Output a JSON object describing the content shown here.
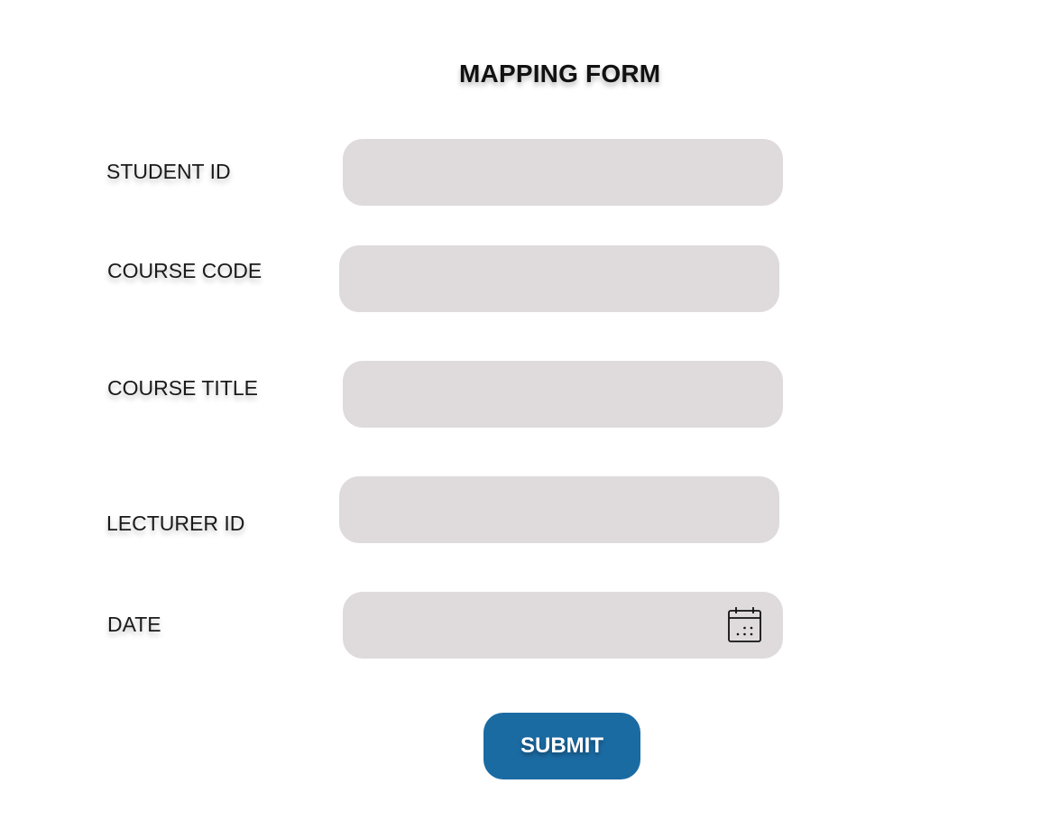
{
  "form": {
    "title": "MAPPING FORM",
    "fields": [
      {
        "label": "STUDENT ID",
        "value": "",
        "placeholder": ""
      },
      {
        "label": "COURSE CODE",
        "value": "",
        "placeholder": ""
      },
      {
        "label": "COURSE TITLE",
        "value": "",
        "placeholder": ""
      },
      {
        "label": "LECTURER ID",
        "value": "",
        "placeholder": ""
      },
      {
        "label": "DATE",
        "value": "",
        "placeholder": "",
        "icon": "calendar-icon"
      }
    ],
    "submit_label": "SUBMIT"
  },
  "colors": {
    "field_background": "#dfdbdc",
    "submit_background": "#1b6ba3",
    "submit_text": "#ffffff",
    "text": "#111111"
  }
}
